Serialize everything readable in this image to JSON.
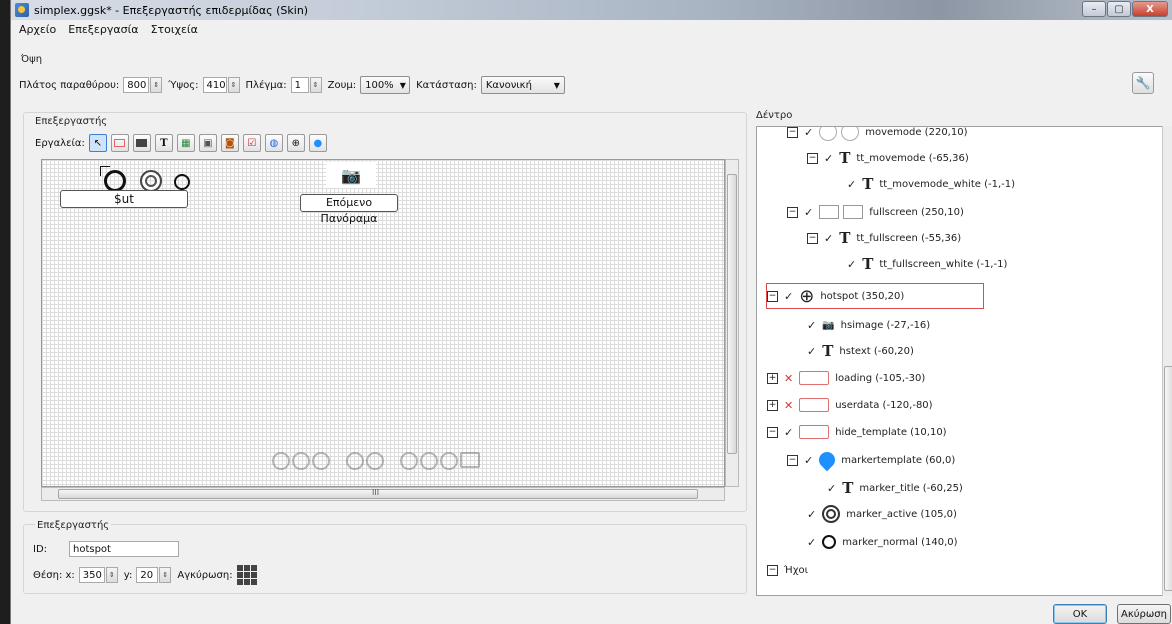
{
  "window": {
    "title": "simplex.ggsk* - Επεξεργαστής επιδερμίδας (Skin)",
    "buttons": [
      "–",
      "▢",
      "X"
    ]
  },
  "menu": [
    "Αρχείο",
    "Επεξεργασία",
    "Στοιχεία"
  ],
  "view": {
    "group_title": "Όψη",
    "width_label": "Πλάτος παραθύρου:",
    "width_value": "800",
    "height_label": "Ύψος:",
    "height_value": "410",
    "grid_label": "Πλέγμα:",
    "grid_value": "1",
    "zoom_label": "Ζουμ:",
    "zoom_value": "100%",
    "state_label": "Κατάσταση:",
    "state_value": "Κανονική"
  },
  "editor": {
    "group_title": "Επεξεργαστής",
    "tools_label": "Εργαλεία:",
    "tools": [
      "cursor-icon",
      "rectangle-icon",
      "container-icon",
      "text-icon",
      "image-icon",
      "button-icon",
      "image-button-icon",
      "checkbox-icon",
      "map-icon",
      "hotspot-icon",
      "marker-icon"
    ],
    "canvas": {
      "label_box_text": "$ut",
      "next_panorama_text": "Επόμενο Πανόραμα",
      "scroll_marker": "III"
    }
  },
  "properties": {
    "group_title": "Επεξεργαστής",
    "id_label": "ID:",
    "id_value": "hotspot",
    "position_label": "Θέση: x:",
    "x_value": "350",
    "y_label": "y:",
    "y_value": "20",
    "anchor_label": "Αγκύρωση:"
  },
  "tree": {
    "title": "Δέντρο",
    "rows": [
      {
        "expand": "⊟",
        "visible": true,
        "icon": "twin-circle-icon",
        "label": "movemode (220,10)"
      },
      {
        "expand": "⊟",
        "visible": true,
        "icon": "text-icon",
        "label": "tt_movemode (-65,36)"
      },
      {
        "expand": "",
        "visible": true,
        "icon": "text-icon",
        "label": "tt_movemode_white (-1,-1)"
      },
      {
        "expand": "⊟",
        "visible": true,
        "icon": "fullscreen-icon",
        "label": "fullscreen (250,10)"
      },
      {
        "expand": "⊟",
        "visible": true,
        "icon": "text-icon",
        "label": "tt_fullscreen (-55,36)"
      },
      {
        "expand": "",
        "visible": true,
        "icon": "text-icon",
        "label": "tt_fullscreen_white (-1,-1)"
      },
      {
        "expand": "⊟",
        "visible": true,
        "icon": "crosshair-icon",
        "label": "hotspot (350,20)"
      },
      {
        "expand": "",
        "visible": true,
        "icon": "camera-icon",
        "label": "hsimage (-27,-16)"
      },
      {
        "expand": "",
        "visible": true,
        "icon": "text-icon",
        "label": "hstext (-60,20)"
      },
      {
        "expand": "⊞",
        "visible": false,
        "icon": "rect-icon",
        "label": "loading (-105,-30)"
      },
      {
        "expand": "⊞",
        "visible": false,
        "icon": "rect-icon",
        "label": "userdata (-120,-80)"
      },
      {
        "expand": "⊟",
        "visible": true,
        "icon": "rect-icon",
        "label": "hide_template (10,10)"
      },
      {
        "expand": "⊟",
        "visible": true,
        "icon": "marker-pin-icon",
        "label": "markertemplate (60,0)"
      },
      {
        "expand": "",
        "visible": true,
        "icon": "text-icon",
        "label": "marker_title (-60,25)"
      },
      {
        "expand": "",
        "visible": true,
        "icon": "double-ring-icon",
        "label": "marker_active (105,0)"
      },
      {
        "expand": "",
        "visible": true,
        "icon": "ring-icon",
        "label": "marker_normal (140,0)"
      },
      {
        "expand": "⊟",
        "visible": null,
        "icon": "",
        "label": "Ήχοι"
      }
    ]
  },
  "buttons": {
    "ok": "OK",
    "cancel": "Ακύρωση"
  },
  "colors": {
    "selection_border": "#e04a4a",
    "marker_blue": "#1e90ff",
    "hidden_x": "#d33333"
  }
}
